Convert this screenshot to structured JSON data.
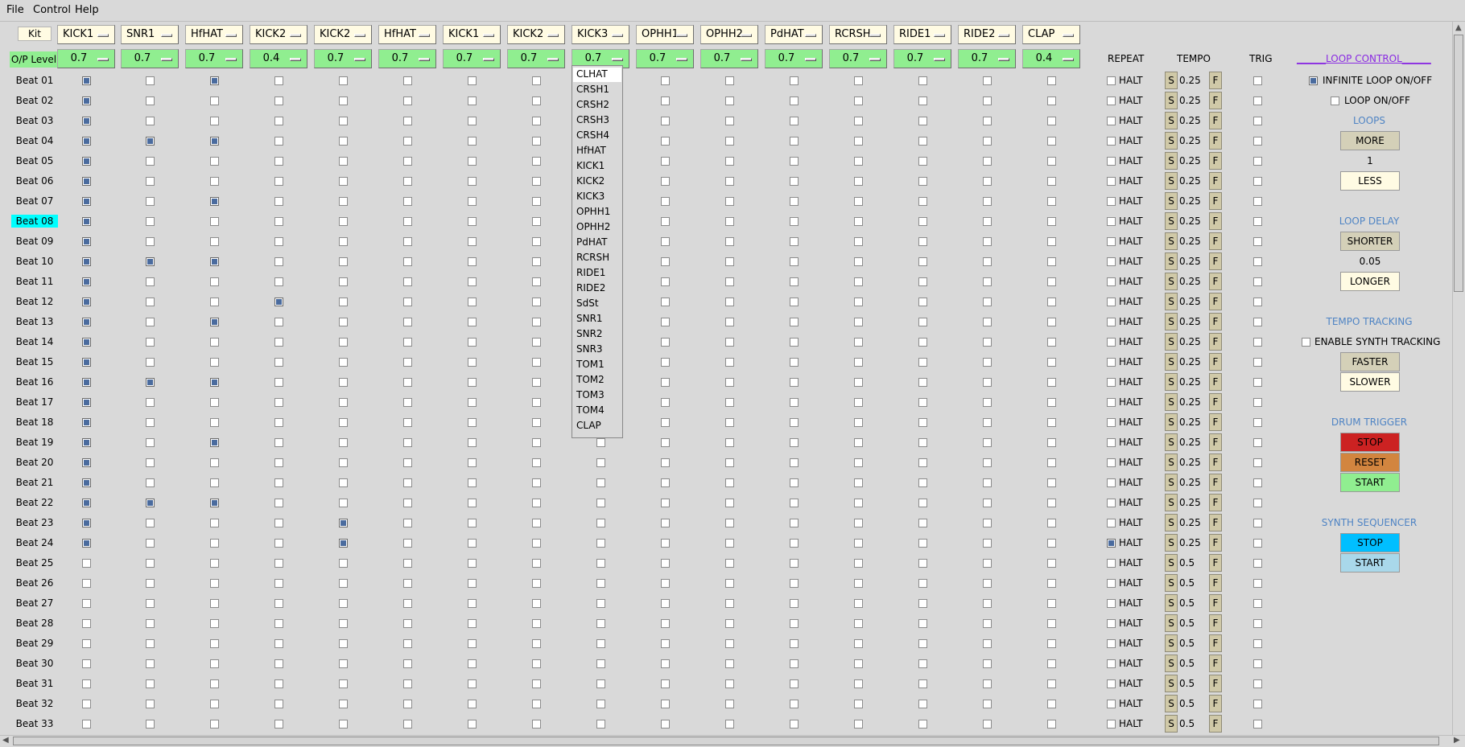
{
  "menu": [
    "File",
    "Control",
    "Help"
  ],
  "kit_label": "Kit",
  "op_level_label": "O/P Level",
  "instruments": [
    "KICK1",
    "SNR1",
    "HfHAT",
    "KICK2",
    "KICK2",
    "HfHAT",
    "KICK1",
    "KICK2",
    "KICK3",
    "OPHH1",
    "OPHH2",
    "PdHAT",
    "RCRSH",
    "RIDE1",
    "RIDE2",
    "CLAP"
  ],
  "levels": [
    "0.7",
    "0.7",
    "0.7",
    "0.4",
    "0.7",
    "0.7",
    "0.7",
    "0.7",
    "0.7",
    "0.7",
    "0.7",
    "0.7",
    "0.7",
    "0.7",
    "0.7",
    "0.4"
  ],
  "headers": {
    "repeat": "REPEAT",
    "tempo": "TEMPO",
    "trig": "TRIG"
  },
  "beats": [
    "Beat 01",
    "Beat 02",
    "Beat 03",
    "Beat 04",
    "Beat 05",
    "Beat 06",
    "Beat 07",
    "Beat 08",
    "Beat 09",
    "Beat 10",
    "Beat 11",
    "Beat 12",
    "Beat 13",
    "Beat 14",
    "Beat 15",
    "Beat 16",
    "Beat 17",
    "Beat 18",
    "Beat 19",
    "Beat 20",
    "Beat 21",
    "Beat 22",
    "Beat 23",
    "Beat 24",
    "Beat 25",
    "Beat 26",
    "Beat 27",
    "Beat 28",
    "Beat 29",
    "Beat 30",
    "Beat 31",
    "Beat 32",
    "Beat 33"
  ],
  "highlighted_beat": 7,
  "checked": {
    "0": [
      0,
      1,
      2,
      3,
      4,
      5,
      6,
      7,
      8,
      9,
      10,
      11,
      12,
      13,
      14,
      15,
      16,
      17,
      18,
      19,
      20,
      21,
      22,
      23
    ],
    "1": [
      3,
      9,
      15,
      21
    ],
    "2": [
      0,
      3,
      6,
      9,
      12,
      15,
      18,
      21
    ],
    "3": [
      11
    ],
    "4": [
      22,
      23
    ]
  },
  "repeat_checked": [
    23
  ],
  "halt_label": "HALT",
  "s_label": "S",
  "f_label": "F",
  "tempo_values": [
    "0.25",
    "0.25",
    "0.25",
    "0.25",
    "0.25",
    "0.25",
    "0.25",
    "0.25",
    "0.25",
    "0.25",
    "0.25",
    "0.25",
    "0.25",
    "0.25",
    "0.25",
    "0.25",
    "0.25",
    "0.25",
    "0.25",
    "0.25",
    "0.25",
    "0.25",
    "0.25",
    "0.25",
    "0.5",
    "0.5",
    "0.5",
    "0.5",
    "0.5",
    "0.5",
    "0.5",
    "0.5",
    "0.5"
  ],
  "dropdown_options": [
    "CLHAT",
    "CRSH1",
    "CRSH2",
    "CRSH3",
    "CRSH4",
    "HfHAT",
    "KICK1",
    "KICK2",
    "KICK3",
    "OPHH1",
    "OPHH2",
    "PdHAT",
    "RCRSH",
    "RIDE1",
    "RIDE2",
    "SdSt",
    "SNR1",
    "SNR2",
    "SNR3",
    "TOM1",
    "TOM2",
    "TOM3",
    "TOM4",
    "CLAP"
  ],
  "dropdown_selected": "CLHAT",
  "loop_control": {
    "title": "______LOOP CONTROL______",
    "infinite_loop_label": "INFINITE LOOP ON/OFF",
    "infinite_loop_checked": true,
    "loop_onoff_label": "LOOP ON/OFF",
    "loop_onoff_checked": false,
    "loops_title": "LOOPS",
    "more_label": "MORE",
    "loops_value": "1",
    "less_label": "LESS",
    "delay_title": "LOOP DELAY",
    "shorter_label": "SHORTER",
    "delay_value": "0.05",
    "longer_label": "LONGER",
    "tempo_tracking_title": "TEMPO TRACKING",
    "synth_tracking_label": "ENABLE SYNTH TRACKING",
    "faster_label": "FASTER",
    "slower_label": "SLOWER",
    "drum_trigger_title": "DRUM TRIGGER",
    "drum_stop_label": "STOP",
    "drum_reset_label": "RESET",
    "drum_start_label": "START",
    "synth_seq_title": "SYNTH SEQUENCER",
    "synth_stop_label": "STOP",
    "synth_start_label": "START"
  },
  "colors": {
    "background": "#d9d9d9",
    "level_green": "#90ee90",
    "cream": "#fffbe3",
    "beat_highlight": "#00ffff",
    "title_purple": "#8a2be2",
    "section_blue": "#4f84c4",
    "drum_stop": "#cc2222",
    "drum_reset": "#d2853f",
    "drum_start": "#90ee90",
    "synth_stop": "#00bfff",
    "synth_start": "#a9d8ea",
    "button_tan": "#d4d0b8"
  }
}
